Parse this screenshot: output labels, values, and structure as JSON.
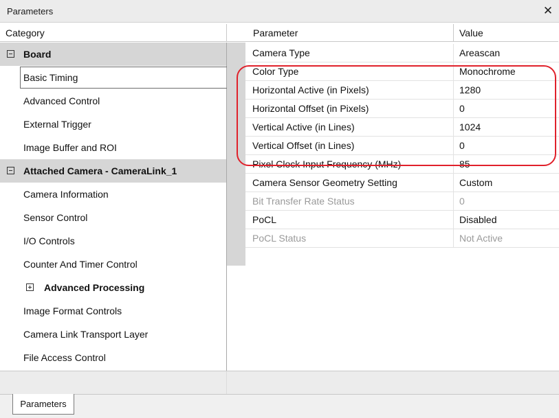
{
  "window": {
    "title": "Parameters",
    "close_glyph": "✕"
  },
  "headers": {
    "category": "Category",
    "parameter": "Parameter",
    "value": "Value"
  },
  "categories": [
    {
      "label": "Board",
      "kind": "group",
      "expanded": true
    },
    {
      "label": "Basic Timing",
      "kind": "item",
      "selected": true
    },
    {
      "label": "Advanced Control",
      "kind": "item"
    },
    {
      "label": "External Trigger",
      "kind": "item"
    },
    {
      "label": "Image Buffer and ROI",
      "kind": "item"
    },
    {
      "label": "Attached Camera - CameraLink_1",
      "kind": "group",
      "expanded": true
    },
    {
      "label": "Camera Information",
      "kind": "item"
    },
    {
      "label": "Sensor Control",
      "kind": "item"
    },
    {
      "label": "I/O Controls",
      "kind": "item"
    },
    {
      "label": "Counter And Timer Control",
      "kind": "item"
    },
    {
      "label": "Advanced Processing",
      "kind": "subgroup",
      "expanded": false
    },
    {
      "label": "Image Format Controls",
      "kind": "item"
    },
    {
      "label": "Camera Link Transport Layer",
      "kind": "item"
    },
    {
      "label": "File Access Control",
      "kind": "item"
    }
  ],
  "parameters": [
    {
      "name": "Camera Type",
      "value": "Areascan",
      "readonly": false
    },
    {
      "name": "Color Type",
      "value": "Monochrome",
      "readonly": false
    },
    {
      "name": "Horizontal Active (in Pixels)",
      "value": "1280",
      "readonly": false
    },
    {
      "name": "Horizontal Offset (in Pixels)",
      "value": "0",
      "readonly": false
    },
    {
      "name": "Vertical Active (in Lines)",
      "value": "1024",
      "readonly": false
    },
    {
      "name": "Vertical Offset (in Lines)",
      "value": "0",
      "readonly": false
    },
    {
      "name": "Pixel Clock Input Frequency (MHz)",
      "value": "85",
      "readonly": false
    },
    {
      "name": "Camera Sensor Geometry Setting",
      "value": "Custom",
      "readonly": false
    },
    {
      "name": "Bit Transfer Rate Status",
      "value": "0",
      "readonly": true
    },
    {
      "name": "PoCL",
      "value": "Disabled",
      "readonly": false
    },
    {
      "name": "PoCL Status",
      "value": "Not Active",
      "readonly": true
    }
  ],
  "tabs": [
    {
      "label": "Parameters",
      "active": true
    }
  ],
  "colors": {
    "highlight": "#e0202a",
    "group_bg": "#d6d6d6",
    "readonly_text": "#9a9a9a"
  }
}
